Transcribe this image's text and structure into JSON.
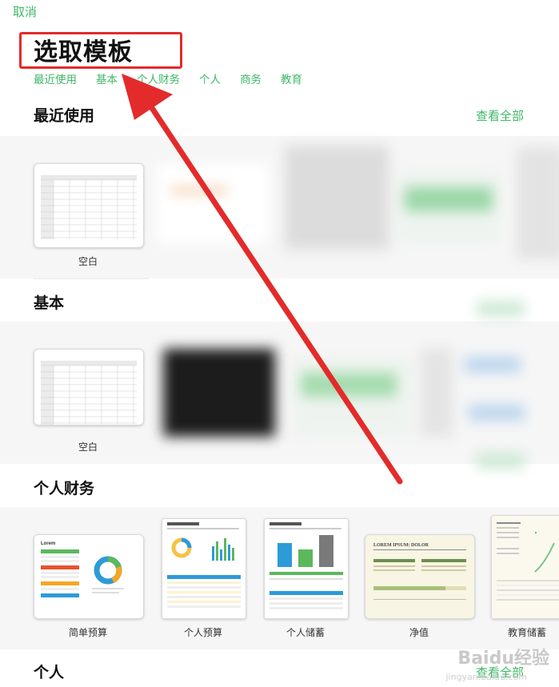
{
  "header": {
    "cancel_label": "取消",
    "title": "选取模板"
  },
  "tabs": [
    "最近使用",
    "基本",
    "个人财务",
    "个人",
    "商务",
    "教育"
  ],
  "sections": {
    "recent": {
      "title": "最近使用",
      "see_all": "查看全部",
      "items": [
        {
          "label": "空白"
        }
      ]
    },
    "basic": {
      "title": "基本",
      "items": [
        {
          "label": "空白"
        }
      ]
    },
    "personal_finance": {
      "title": "个人财务",
      "items": [
        {
          "label": "简单预算"
        },
        {
          "label": "个人预算"
        },
        {
          "label": "个人储蓄"
        },
        {
          "label": "净值"
        },
        {
          "label": "教育储蓄"
        }
      ]
    },
    "personal": {
      "title": "个人",
      "see_all": "查看全部"
    }
  },
  "colors": {
    "accent": "#3fb868",
    "annotation": "#e32b2b"
  },
  "watermark": {
    "brand": "Baidu经验",
    "url": "jingyan.baidu.com"
  }
}
